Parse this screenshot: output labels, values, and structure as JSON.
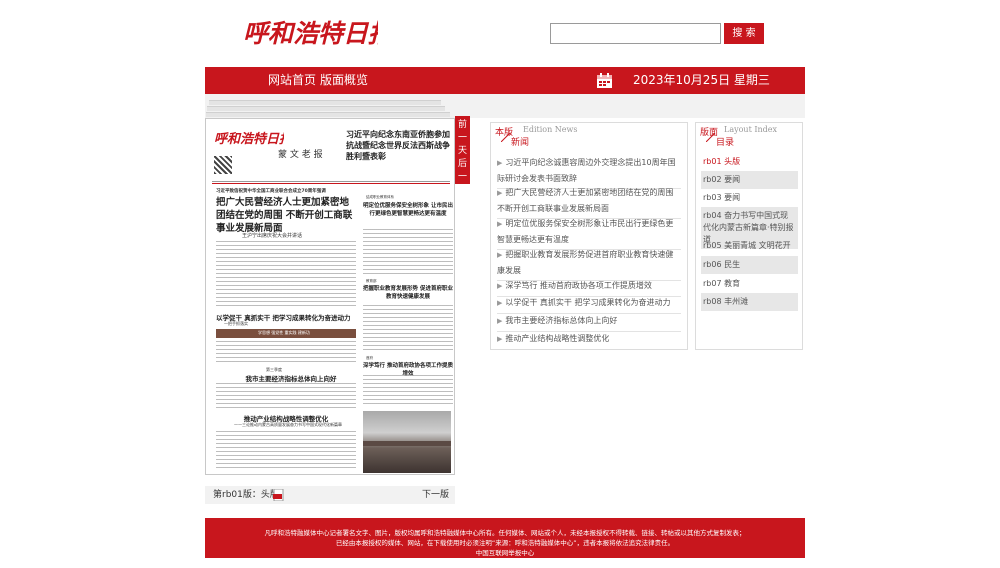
{
  "header": {
    "logo_text": "呼和浩特日报",
    "search": {
      "placeholder": "",
      "button_label": "搜 索"
    }
  },
  "nav": {
    "home": "网站首页",
    "overview": "版面概览",
    "date": "2023年10月25日 星期三"
  },
  "pager": {
    "label": "前一天后一天"
  },
  "paper": {
    "masthead": "呼和浩特日报",
    "masthead_headline": "习近平向纪念东南亚侨胞参加抗战暨纪念世界反法西斯战争胜利暨表彰",
    "calligraphy": "蒙 文 老 报",
    "lead_kicker": "习近平致信祝贺中华全国工商业联合会成立70周年强调",
    "lead_headline": "把广大民营经济人士更加紧密地团结在党的周围 不断开创工商联事业发展新局面",
    "lead_sub": "王沪宁出席庆祝大会并讲话",
    "right_kicker": "结成职业教育体系",
    "right_headline": "明定位优服务保安全树形象 让市民出行更绿色更智慧更畅达更有温度",
    "right_kicker2": "教育部",
    "right_headline2": "把握职业教育发展形势 促进首府职业教育快速健康发展",
    "right_kicker3": "首府",
    "right_headline3": "深学笃行 推动首府政协各项工作提质增效",
    "mid_headline": "以学促干 真抓实干 把学习成果转化为奋进动力",
    "mid_sub": "一把手抓落实",
    "photo_caption": "学思想 强党性 重实践 建新功",
    "section_kicker": "第三季度",
    "section_headline": "我市主要经济指标总体向上向好",
    "bottom_headline": "推动产业结构战略性调整优化",
    "bottom_sub": "——三论推动内蒙古高质量发展奋力书写中国式现代化新篇章",
    "footer_label": "第rb01版：头版",
    "next_label": "下一版"
  },
  "news": {
    "title_cn": "本版",
    "title_en": "Edition News",
    "subtitle": "新闻",
    "items": [
      "习近平向纪念诚惠容周边外交理念提出10周年国际研讨会发表书面致辞",
      "把广大民营经济人士更加紧密地团结在党的周围不断开创工商联事业发展新局面",
      "明定位优服务保安全树形象让市民出行更绿色更智慧更畅达更有温度",
      "把握职业教育发展形势促进首府职业教育快速健康发展",
      "深学笃行 推动首府政协各项工作提质增效",
      "以学促干 真抓实干 把学习成果转化为奋进动力",
      "我市主要经济指标总体向上向好",
      "推动产业结构战略性调整优化"
    ]
  },
  "layout_index": {
    "title_cn": "版面",
    "title_en": "Layout Index",
    "subtitle": "目录",
    "items": [
      "rb01 头版",
      "rb02 要闻",
      "rb03 要闻",
      "rb04 奋力书写中国式现代化内蒙古新篇章·特别报道",
      "rb05 美丽青城 文明花开",
      "rb06 民生",
      "rb07 教育",
      "rb08 丰州滩"
    ]
  },
  "footer": {
    "line1": "凡呼和浩特融媒体中心记者署名文字、图片，版权均属呼和浩特融媒体中心所有。任何媒体、网站或个人，未经本报授权不得转载、链接、转帖或以其他方式复制发表；",
    "line2": "已经由本报授权的媒体、网站，在下载使用时必须注明“来源：呼和浩特融媒体中心”，违者本报将依法追究法律责任。",
    "line3": "中国互联网举报中心"
  },
  "colors": {
    "brand_red": "#c8161d"
  }
}
